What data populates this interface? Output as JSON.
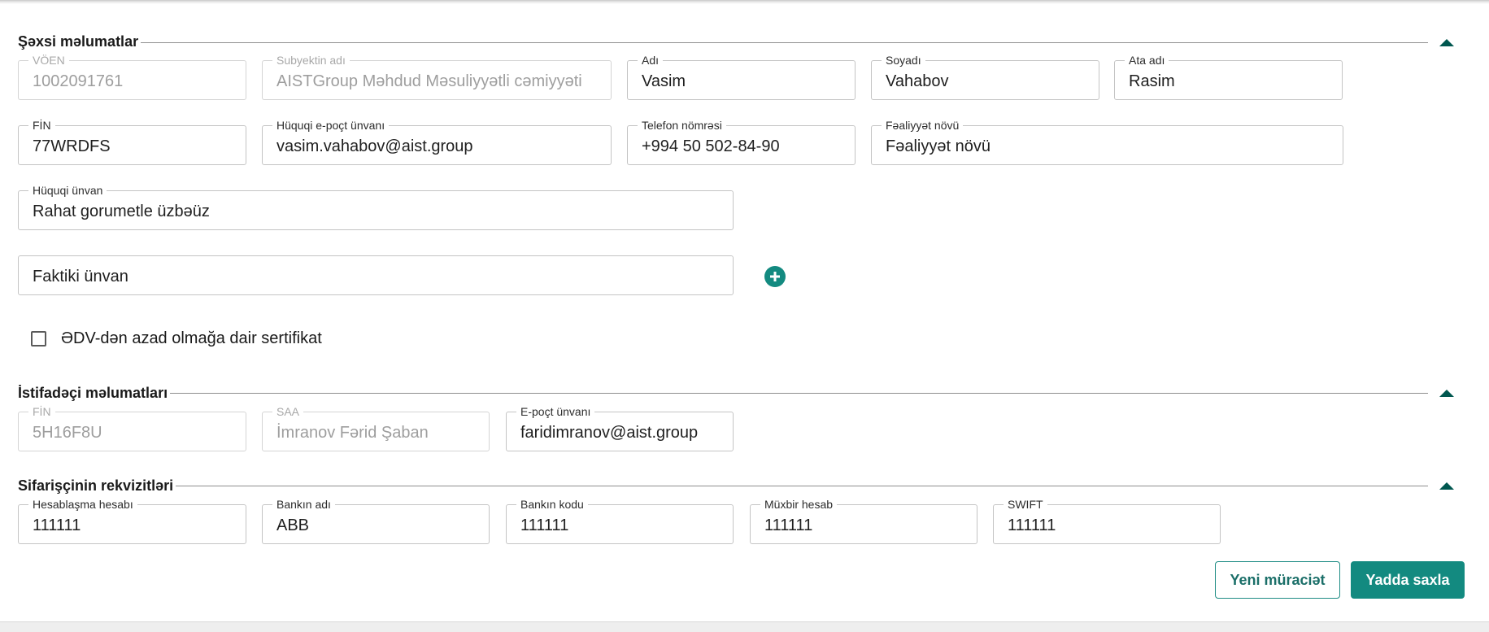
{
  "colors": {
    "accent": "#138a80",
    "accent_dark": "#00574f",
    "border": "#c4c4c4",
    "disabled_text": "#9e9e9e"
  },
  "icons": {
    "collapse": "chevron-up-icon",
    "add": "plus-circle-icon",
    "checkbox": "checkbox-unchecked-icon"
  },
  "personal": {
    "title": "Şəxsi məlumatlar",
    "voen": {
      "label": "VÖEN",
      "value": "1002091761"
    },
    "subject": {
      "label": "Subyektin adı",
      "value": "AISTGroup Məhdud Məsuliyyətli cəmiyyəti"
    },
    "name": {
      "label": "Adı",
      "value": "Vasim"
    },
    "surname": {
      "label": "Soyadı",
      "value": "Vahabov"
    },
    "patronymic": {
      "label": "Ata adı",
      "value": "Rasim"
    },
    "fin": {
      "label": "FİN",
      "value": "77WRDFS"
    },
    "email": {
      "label": "Hüquqi e-poçt ünvanı",
      "value": "vasim.vahabov@aist.group"
    },
    "phone": {
      "label": "Telefon nömrəsi",
      "value": "+994 50 502-84-90"
    },
    "activity": {
      "label": "Fəaliyyət növü",
      "value": "Fəaliyyət növü"
    },
    "legal_address": {
      "label": "Hüquqi ünvan",
      "value": "Rahat gorumetle üzbəüz"
    },
    "actual_address": {
      "placeholder": "Faktiki ünvan"
    },
    "vat_certificate_label": "ƏDV-dən azad olmağa dair sertifikat"
  },
  "user": {
    "title": "İstifadəçi məlumatları",
    "fin": {
      "label": "FİN",
      "value": "5H16F8U"
    },
    "saa": {
      "label": "SAA",
      "value": "İmranov Fərid Şaban"
    },
    "email": {
      "label": "E-poçt ünvanı",
      "value": "faridimranov@aist.group"
    }
  },
  "requisites": {
    "title": "Sifarişçinin rekvizitləri",
    "account": {
      "label": "Hesablaşma hesabı",
      "value": "111111"
    },
    "bank_name": {
      "label": "Bankın adı",
      "value": "ABB"
    },
    "bank_code": {
      "label": "Bankın kodu",
      "value": "111111"
    },
    "corr_account": {
      "label": "Müxbir hesab",
      "value": "111111"
    },
    "swift": {
      "label": "SWIFT",
      "value": "111111"
    }
  },
  "actions": {
    "new_request": "Yeni müraciət",
    "save": "Yadda saxla"
  }
}
